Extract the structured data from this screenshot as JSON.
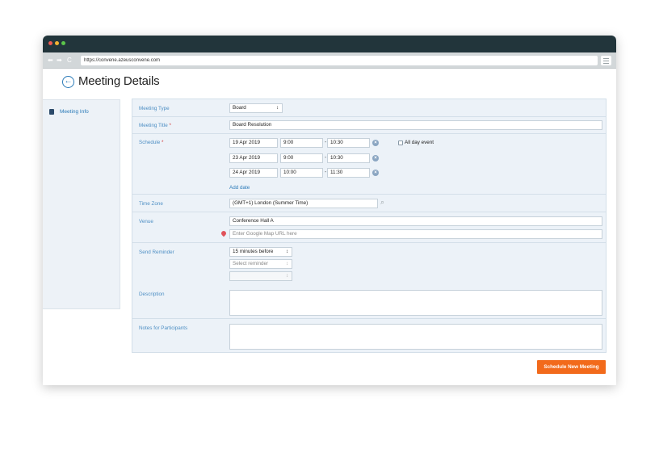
{
  "browser": {
    "url": "https://convene.azeusconvene.com",
    "nav_back": "⬅",
    "nav_forward": "➡",
    "nav_reload": "C"
  },
  "page": {
    "title": "Meeting Details",
    "back_icon": "←"
  },
  "sidebar": {
    "items": [
      {
        "label": "Meeting Info",
        "icon": "book-icon"
      }
    ]
  },
  "form": {
    "meeting_type": {
      "label": "Meeting Type",
      "value": "Board"
    },
    "meeting_title": {
      "label": "Meeting Title",
      "required_mark": "*",
      "value": "Board Resolution"
    },
    "schedule": {
      "label": "Schedule",
      "required_mark": "*",
      "rows": [
        {
          "date": "19 Apr 2019",
          "start": "9:00",
          "end": "10:30"
        },
        {
          "date": "23 Apr 2019",
          "start": "9:00",
          "end": "10:30"
        },
        {
          "date": "24 Apr 2019",
          "start": "10:00",
          "end": "11:30"
        }
      ],
      "dash": "-",
      "clear_icon": "×",
      "all_day_label": "All day event",
      "add_date_link": "Add date"
    },
    "time_zone": {
      "label": "Time Zone",
      "value": "(GMT+1) London (Summer Time)",
      "search_icon": "⌕"
    },
    "venue": {
      "label": "Venue",
      "value": "Conference Hall A",
      "map_placeholder": "Enter Google Map URL here"
    },
    "send_reminder": {
      "label": "Send Reminder",
      "value": "15 minutes before",
      "second_placeholder": "Select reminder",
      "third_value": ""
    },
    "description": {
      "label": "Description",
      "value": ""
    },
    "notes": {
      "label": "Notes for Participants",
      "value": ""
    },
    "select_arrow": "↕"
  },
  "actions": {
    "schedule_button": "Schedule New Meeting"
  },
  "colors": {
    "titlebar": "#22353b",
    "accent": "#2a7ab8",
    "primary_button": "#f26a1b",
    "form_bg": "#ecf2f8",
    "label": "#4e8fc4"
  }
}
